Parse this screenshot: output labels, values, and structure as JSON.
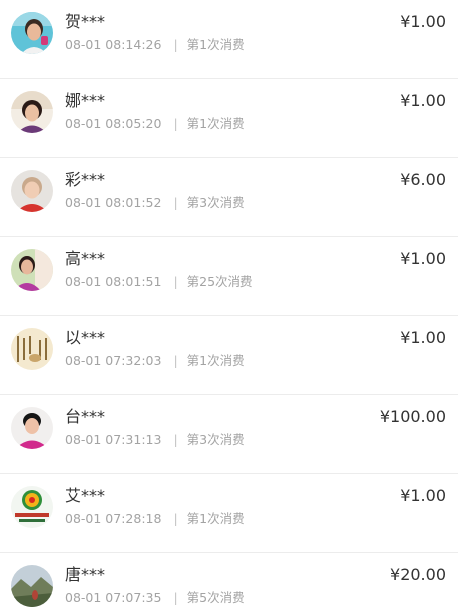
{
  "records": [
    {
      "name": "贺***",
      "time": "08-01 08:14:26",
      "count_text": "第1次消费",
      "amount": "¥1.00"
    },
    {
      "name": "娜***",
      "time": "08-01 08:05:20",
      "count_text": "第1次消费",
      "amount": "¥1.00"
    },
    {
      "name": "彩***",
      "time": "08-01 08:01:52",
      "count_text": "第3次消费",
      "amount": "¥6.00"
    },
    {
      "name": "高***",
      "time": "08-01 08:01:51",
      "count_text": "第25次消费",
      "amount": "¥1.00"
    },
    {
      "name": "以***",
      "time": "08-01 07:32:03",
      "count_text": "第1次消费",
      "amount": "¥1.00"
    },
    {
      "name": "台***",
      "time": "08-01 07:31:13",
      "count_text": "第3次消费",
      "amount": "¥100.00"
    },
    {
      "name": "艾***",
      "time": "08-01 07:28:18",
      "count_text": "第1次消费",
      "amount": "¥1.00"
    },
    {
      "name": "唐***",
      "time": "08-01 07:07:35",
      "count_text": "第5次消费",
      "amount": "¥20.00"
    }
  ],
  "separator": "|"
}
